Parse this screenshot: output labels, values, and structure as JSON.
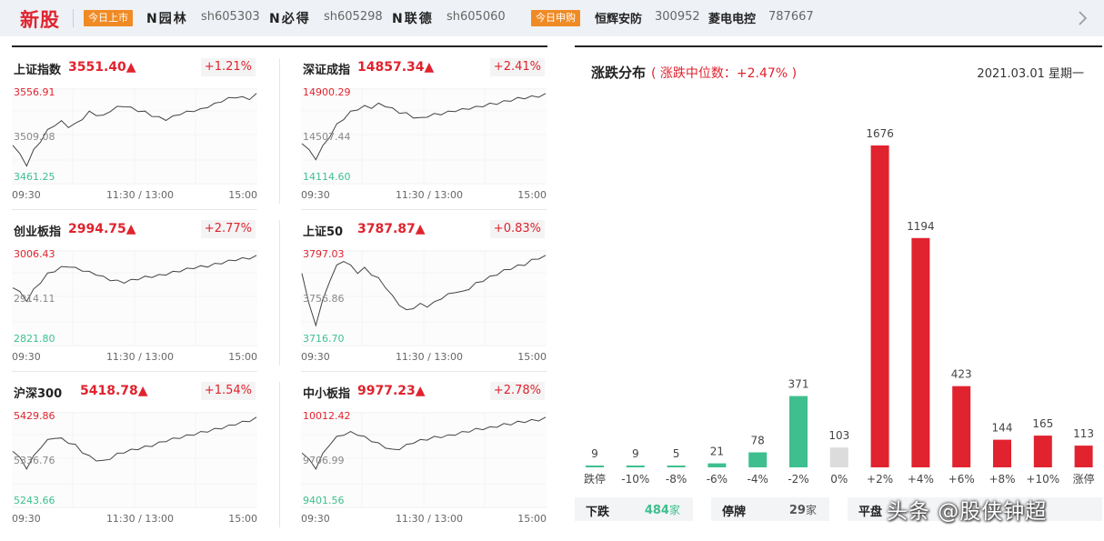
{
  "topbar": {
    "logo": "新股",
    "today_listing_tag": "今日上市",
    "listings": [
      {
        "name": "N园林",
        "code": "sh605303"
      },
      {
        "name": "N必得",
        "code": "sh605298"
      },
      {
        "name": "N联德",
        "code": "sh605060"
      }
    ],
    "today_subscribe_tag": "今日申购",
    "subscriptions": [
      {
        "name": "恒辉安防",
        "code": "300952"
      },
      {
        "name": "菱电电控",
        "code": "787667"
      }
    ]
  },
  "colors": {
    "up": "#e0232e",
    "down": "#3fbf8f",
    "flat": "#dcdcdc",
    "line": "#444444"
  },
  "indices": [
    {
      "name": "上证指数",
      "value": "3551.40▲",
      "pct": "+1.21%",
      "high": "3556.91",
      "mid": "3509.08",
      "low": "3461.25",
      "t_start": "09:30",
      "t_mid": "11:30 / 13:00",
      "t_end": "15:00",
      "series": [
        0.38,
        0.25,
        0.12,
        0.3,
        0.42,
        0.55,
        0.62,
        0.66,
        0.6,
        0.63,
        0.7,
        0.78,
        0.75,
        0.73,
        0.8,
        0.84,
        0.86,
        0.83,
        0.8,
        0.78,
        0.74,
        0.71,
        0.69,
        0.72,
        0.76,
        0.78,
        0.8,
        0.81,
        0.85,
        0.88,
        0.92,
        0.95,
        0.97,
        0.96,
        0.95,
        1.0
      ]
    },
    {
      "name": "深证成指",
      "value": "14857.34▲",
      "pct": "+2.41%",
      "high": "14900.29",
      "mid": "14507.44",
      "low": "14114.60",
      "t_start": "09:30",
      "t_mid": "11:30 / 13:00",
      "t_end": "15:00",
      "series": [
        0.4,
        0.3,
        0.2,
        0.35,
        0.48,
        0.62,
        0.7,
        0.78,
        0.82,
        0.85,
        0.84,
        0.88,
        0.86,
        0.82,
        0.78,
        0.76,
        0.72,
        0.7,
        0.73,
        0.75,
        0.76,
        0.78,
        0.8,
        0.81,
        0.83,
        0.84,
        0.86,
        0.88,
        0.89,
        0.91,
        0.93,
        0.95,
        0.96,
        0.97,
        0.98,
        1.0
      ]
    },
    {
      "name": "创业板指",
      "value": "2994.75▲",
      "pct": "+2.77%",
      "high": "3006.43",
      "mid": "2914.11",
      "low": "2821.80",
      "t_start": "09:30",
      "t_mid": "11:30 / 13:00",
      "t_end": "15:00",
      "series": [
        0.62,
        0.55,
        0.45,
        0.58,
        0.68,
        0.78,
        0.82,
        0.86,
        0.88,
        0.85,
        0.83,
        0.8,
        0.78,
        0.74,
        0.71,
        0.69,
        0.68,
        0.7,
        0.72,
        0.74,
        0.75,
        0.76,
        0.78,
        0.8,
        0.82,
        0.84,
        0.86,
        0.87,
        0.88,
        0.9,
        0.92,
        0.94,
        0.96,
        0.97,
        0.98,
        1.0
      ]
    },
    {
      "name": "上证50",
      "value": "3787.87▲",
      "pct": "+0.83%",
      "high": "3797.03",
      "mid": "3756.86",
      "low": "3716.70",
      "t_start": "09:30",
      "t_mid": "11:30 / 13:00",
      "t_end": "15:00",
      "series": [
        0.8,
        0.4,
        0.15,
        0.45,
        0.7,
        0.88,
        0.95,
        0.88,
        0.8,
        0.85,
        0.78,
        0.72,
        0.62,
        0.5,
        0.4,
        0.32,
        0.36,
        0.4,
        0.38,
        0.42,
        0.48,
        0.52,
        0.56,
        0.55,
        0.6,
        0.66,
        0.7,
        0.74,
        0.78,
        0.82,
        0.85,
        0.88,
        0.9,
        0.95,
        0.98,
        1.0
      ]
    },
    {
      "name": "沪深300",
      "value": "5418.78▲",
      "pct": "+1.54%",
      "high": "5429.86",
      "mid": "5336.76",
      "low": "5243.66",
      "t_start": "09:30",
      "t_mid": "11:30 / 13:00",
      "t_end": "15:00",
      "series": [
        0.6,
        0.5,
        0.38,
        0.52,
        0.64,
        0.72,
        0.76,
        0.74,
        0.7,
        0.66,
        0.58,
        0.52,
        0.48,
        0.46,
        0.5,
        0.55,
        0.58,
        0.6,
        0.62,
        0.64,
        0.66,
        0.69,
        0.72,
        0.74,
        0.76,
        0.78,
        0.8,
        0.82,
        0.84,
        0.86,
        0.88,
        0.9,
        0.93,
        0.95,
        0.97,
        1.0
      ]
    },
    {
      "name": "中小板指",
      "value": "9977.23▲",
      "pct": "+2.78%",
      "high": "10012.42",
      "mid": "9706.99",
      "low": "9401.56",
      "t_start": "09:30",
      "t_mid": "11:30 / 13:00",
      "t_end": "15:00",
      "series": [
        0.58,
        0.48,
        0.38,
        0.55,
        0.68,
        0.76,
        0.8,
        0.82,
        0.8,
        0.76,
        0.72,
        0.68,
        0.64,
        0.6,
        0.62,
        0.66,
        0.7,
        0.72,
        0.74,
        0.76,
        0.77,
        0.78,
        0.8,
        0.82,
        0.84,
        0.86,
        0.87,
        0.88,
        0.9,
        0.92,
        0.93,
        0.95,
        0.96,
        0.97,
        0.98,
        1.0
      ]
    }
  ],
  "distribution": {
    "title": "涨跌分布",
    "subtitle": "( 涨跌中位数：+2.47% )",
    "date": "2021.03.01 星期一",
    "chart_data": {
      "type": "bar",
      "categories": [
        "跌停",
        "-10%",
        "-8%",
        "-6%",
        "-4%",
        "-2%",
        "0%",
        "+2%",
        "+4%",
        "+6%",
        "+8%",
        "+10%",
        "涨停"
      ],
      "values": [
        9,
        9,
        5,
        21,
        78,
        371,
        103,
        1676,
        1194,
        423,
        144,
        165,
        113
      ],
      "colors": [
        "down",
        "down",
        "down",
        "down",
        "down",
        "down",
        "flat",
        "up",
        "up",
        "up",
        "up",
        "up",
        "up"
      ],
      "ylim": [
        0,
        1676
      ]
    }
  },
  "stats": [
    {
      "label": "下跌",
      "value": "484",
      "unit": "家",
      "color": "#3fbf8f"
    },
    {
      "label": "停牌",
      "value": "29",
      "unit": "家",
      "color": "#555555"
    },
    {
      "label": "平盘",
      "value": "",
      "unit": "",
      "color": "#e0232e"
    }
  ],
  "watermark": "头条 @股侠钟超"
}
